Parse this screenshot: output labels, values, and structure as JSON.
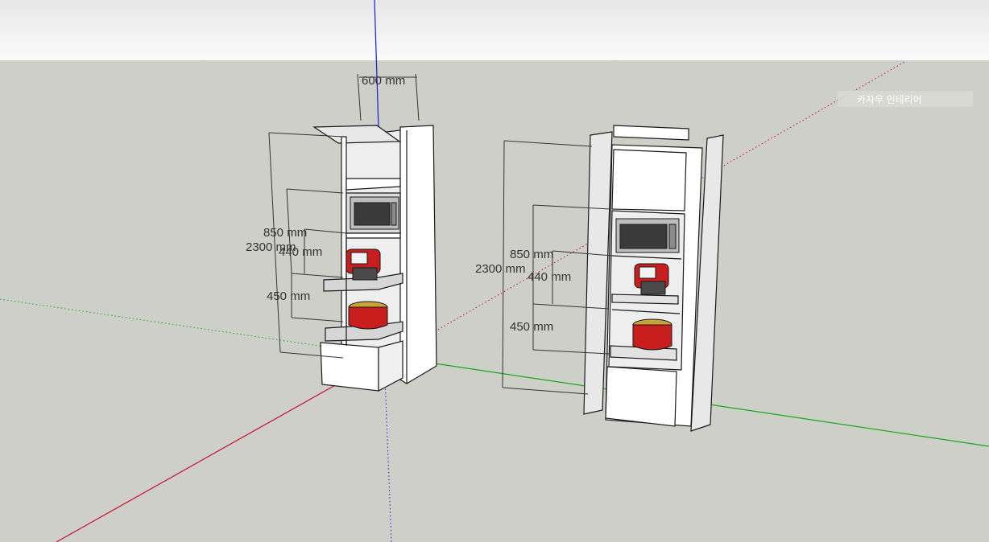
{
  "scene": {
    "colors": {
      "sky": "#f4f4f4",
      "ground": "#cfcfca",
      "axis_red": "#c8102e",
      "axis_green": "#17a817",
      "axis_blue": "#1b1bd6",
      "cabinet_face": "#ffffff",
      "cabinet_edge": "#1a1a1a",
      "interior": "#f1f1f1",
      "appliance_red": "#c81e1e",
      "dimension_line": "#333333"
    },
    "watermark_tag": "카자우 인테리어"
  },
  "cabinet_left": {
    "dim_width": "600 mm",
    "dim_total_height": "2300 mm",
    "dim_upper": "850 mm",
    "dim_middle": "440 mm",
    "dim_lower": "450 mm",
    "appliances": [
      "microwave-icon",
      "air-fryer-icon",
      "rice-cooker-icon"
    ]
  },
  "cabinet_right": {
    "dim_total_height": "2300 mm",
    "dim_upper": "850 mm",
    "dim_middle": "440 mm",
    "dim_lower": "450 mm",
    "appliances": [
      "microwave-icon",
      "air-fryer-icon",
      "rice-cooker-icon"
    ]
  }
}
